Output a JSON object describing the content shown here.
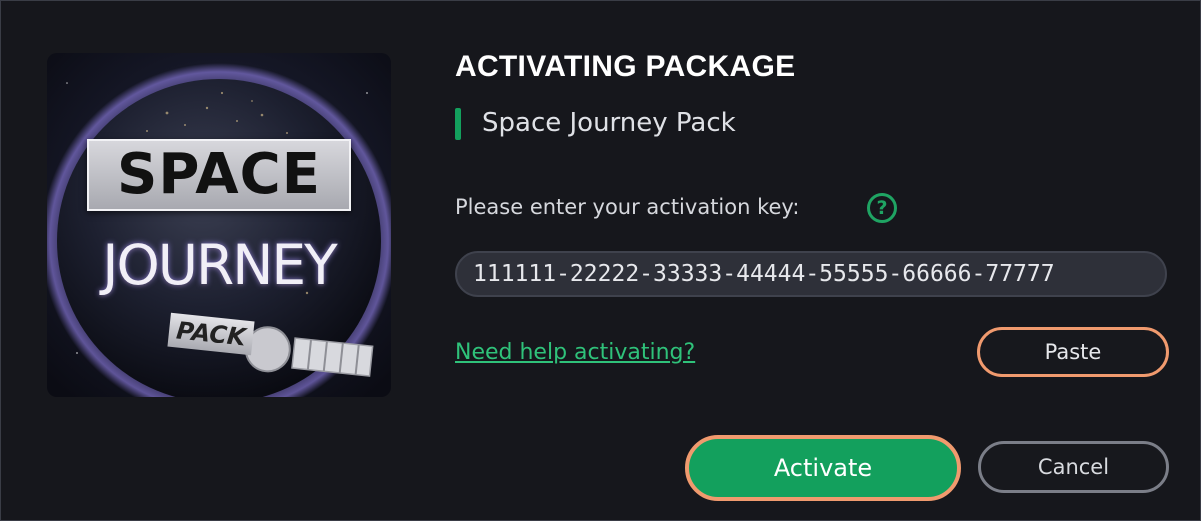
{
  "dialog": {
    "title": "ACTIVATING PACKAGE",
    "package_name": "Space Journey Pack",
    "artwork": {
      "line1": "SPACE",
      "line2": "JOURNEY",
      "line3": "PACK"
    },
    "key_label": "Please enter your activation key:",
    "help_icon": {
      "icon": "question-circle-icon",
      "glyph": "?"
    },
    "key_input": {
      "value": "111111-22222-33333-44444-55555-66666-77777",
      "placeholder": ""
    },
    "help_link": "Need help activating?",
    "paste_label": "Paste",
    "activate_label": "Activate",
    "cancel_label": "Cancel"
  },
  "colors": {
    "background": "#16171c",
    "accent_green": "#13a05d",
    "link_green": "#2fc27a",
    "highlight_outline": "#f09a6e"
  }
}
